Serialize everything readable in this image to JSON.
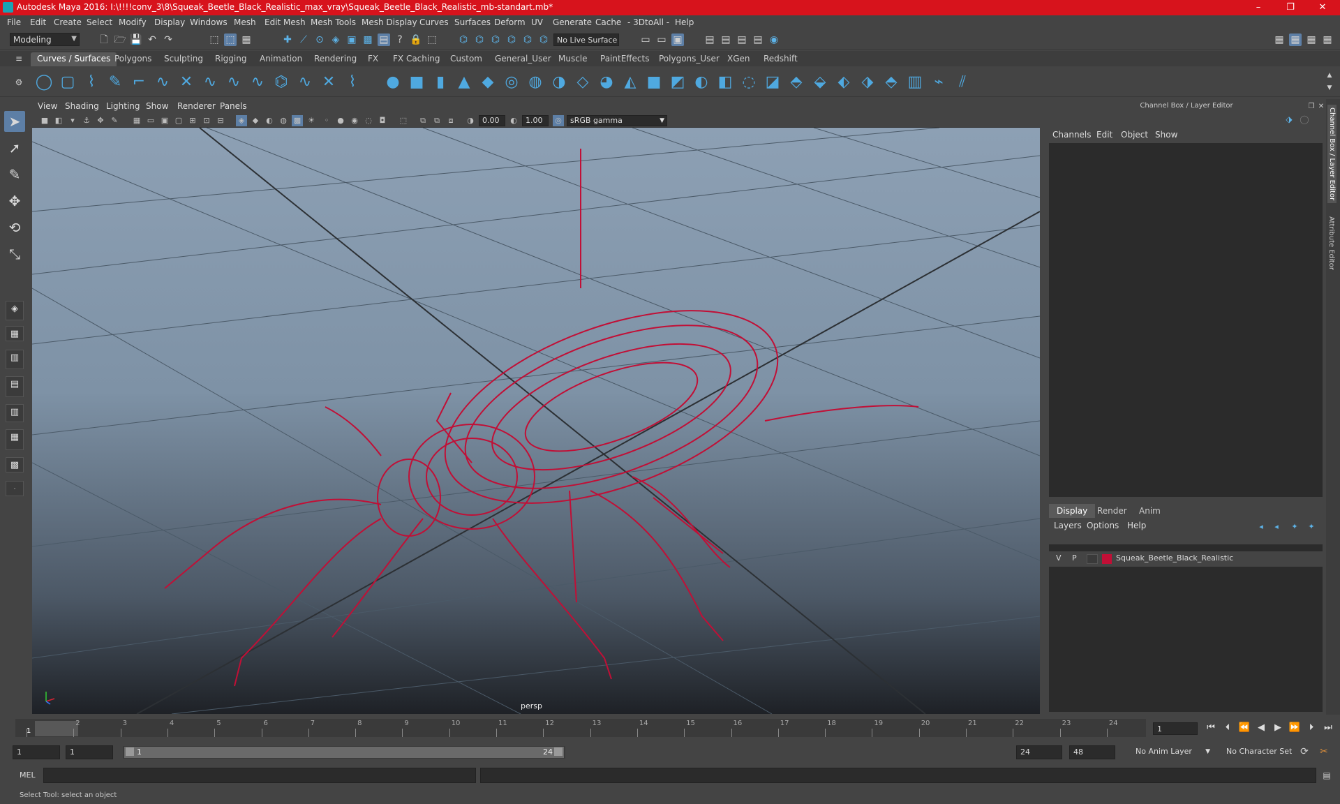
{
  "window": {
    "title": "Autodesk Maya 2016: I:\\!!!!conv_3\\8\\Squeak_Beetle_Black_Realistic_max_vray\\Squeak_Beetle_Black_Realistic_mb-standart.mb*",
    "minimize": "–",
    "maximize": "❐",
    "close": "✕"
  },
  "menubar": [
    "File",
    "Edit",
    "Create",
    "Select",
    "Modify",
    "Display",
    "Windows",
    "Mesh",
    "Edit Mesh",
    "Mesh Tools",
    "Mesh Display",
    "Curves",
    "Surfaces",
    "Deform",
    "UV",
    "Generate",
    "Cache",
    "- 3DtoAll -",
    "Help"
  ],
  "status": {
    "mode": "Modeling",
    "live_surface": "No Live Surface"
  },
  "shelf_tabs": [
    "Curves / Surfaces",
    "Polygons",
    "Sculpting",
    "Rigging",
    "Animation",
    "Rendering",
    "FX",
    "FX Caching",
    "Custom",
    "General_User",
    "Muscle",
    "PaintEffects",
    "Polygons_User",
    "XGen",
    "Redshift"
  ],
  "viewport": {
    "menu": [
      "View",
      "Shading",
      "Lighting",
      "Show",
      "Renderer",
      "Panels"
    ],
    "exposure": "0.00",
    "gamma": "1.00",
    "color_space": "sRGB gamma",
    "camera": "persp"
  },
  "channel_box": {
    "title": "Channel Box / Layer Editor",
    "menu": [
      "Channels",
      "Edit",
      "Object",
      "Show"
    ]
  },
  "layer_editor": {
    "tabs": [
      "Display",
      "Render",
      "Anim"
    ],
    "menu": [
      "Layers",
      "Options",
      "Help"
    ],
    "layer": {
      "v": "V",
      "p": "P",
      "name": "Squeak_Beetle_Black_Realistic",
      "color": "#c10f36"
    }
  },
  "side_tabs": [
    "Channel Box / Layer Editor",
    "Attribute Editor"
  ],
  "timeline": {
    "ticks": [
      "1",
      "2",
      "3",
      "4",
      "5",
      "6",
      "7",
      "8",
      "9",
      "10",
      "11",
      "12",
      "13",
      "14",
      "15",
      "16",
      "17",
      "18",
      "19",
      "20",
      "21",
      "22",
      "23",
      "24"
    ],
    "current_frame": "1",
    "current_field": "1"
  },
  "range": {
    "start": "1",
    "playback_start": "1",
    "slider_start": "1",
    "slider_end": "24",
    "playback_end": "24",
    "end": "48",
    "anim_layer": "No Anim Layer",
    "character_set": "No Character Set"
  },
  "command": {
    "label": "MEL"
  },
  "help_line": "Select Tool: select an object",
  "colors": {
    "title_bar": "#d7131c",
    "accent": "#5d7fa6",
    "wireframe": "#c10f36"
  }
}
